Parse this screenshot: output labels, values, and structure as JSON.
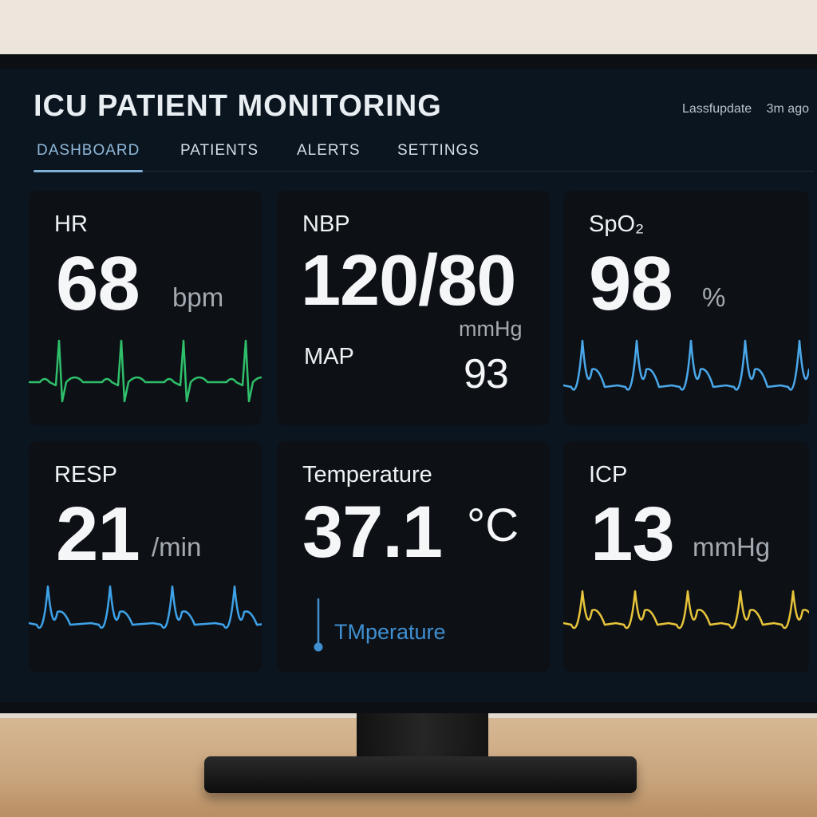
{
  "header": {
    "title": "ICU PATIENT MONITORING",
    "last_update_label": "Lassfupdate",
    "last_update_value": "3m ago"
  },
  "nav": {
    "tabs": [
      {
        "label": "DASHBOARD",
        "active": true
      },
      {
        "label": "PATIENTS",
        "active": false
      },
      {
        "label": "ALERTS",
        "active": false
      },
      {
        "label": "SETTINGS",
        "active": false
      }
    ]
  },
  "cards": {
    "hr": {
      "label": "HR",
      "value": "68",
      "unit": "bpm",
      "wave_color": "#2fbf6a",
      "wave_type": "ecg"
    },
    "nbp": {
      "label": "NBP",
      "value": "120/80",
      "unit": "mmHg",
      "map_label": "MAP",
      "map_value": "93"
    },
    "spo2": {
      "label": "SpO₂",
      "value": "98",
      "unit": "%",
      "wave_color": "#4aa8ea",
      "wave_type": "pleth"
    },
    "resp": {
      "label": "RESP",
      "value": "21",
      "unit": "/min",
      "wave_color": "#3ea2e8",
      "wave_type": "resp"
    },
    "temp": {
      "label": "Temperature",
      "value": "37.1",
      "unit": "°C",
      "caption": "TMperature",
      "icon": "thermometer-icon",
      "accent": "#3f8fd1"
    },
    "icp": {
      "label": "ICP",
      "value": "13",
      "unit": "mmHg",
      "wave_color": "#e7c43a",
      "wave_type": "icp"
    }
  },
  "colors": {
    "screen_bg": "#0b1520",
    "card_bg": "#0d1116",
    "accent_tab": "#7fb0d6"
  }
}
